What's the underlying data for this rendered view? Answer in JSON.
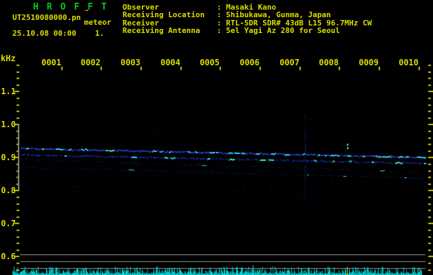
{
  "header": {
    "title": "HROFFT",
    "filename": "UT2510080000.pn",
    "filename_mark": "¨",
    "filename_overlay": "meteor",
    "datetime": "25.10.08 00:00",
    "page": "1.",
    "separator": ": ",
    "fields": [
      {
        "label": "Observer",
        "value": "Masaki Kano"
      },
      {
        "label": "Receiving Location",
        "value": "Shibukawa, Gunma, Japan"
      },
      {
        "label": "Receiver",
        "value": "RTL-SDR SDR# 43dB L15 96.7MHz CW"
      },
      {
        "label": "Receiving Antenna",
        "value": "5el Yagi Az 280 for Seoul"
      }
    ]
  },
  "axes": {
    "freq_unit": "kHz",
    "freq_ticks": [
      "1.1",
      "1.0",
      "0.9",
      "0.8",
      "0.7",
      "0.6"
    ],
    "time_ticks": [
      "0001'",
      "0002'",
      "0003'",
      "0004'",
      "0005'",
      "0006'",
      "0007'",
      "0008'",
      "0009'",
      "0010'"
    ]
  },
  "colors": {
    "title_green": "#00cc22",
    "text_yellow": "#dcdc00",
    "tick_yellow": "#c8c800",
    "gray_line": "#9a9a9a",
    "trace_blue": "#2850ff",
    "trace_bright_cyan": "#38d8ff",
    "trace_green_fleck": "#40ffa0",
    "echo_dot_green": "#3cf08c",
    "noise_cyan": "#00e4e4",
    "marker_yellow": "#dcdc00"
  },
  "chart_data": {
    "type": "heatmap",
    "title": "HROFFT 10-minute meteor radio spectrogram, 25.10.08 00:00 UT",
    "x_axis": {
      "tick_labels": [
        "0001'",
        "0002'",
        "0003'",
        "0004'",
        "0005'",
        "0006'",
        "0007'",
        "0008'",
        "0009'",
        "0010'"
      ],
      "range_minutes": [
        0,
        10
      ]
    },
    "y_axis": {
      "unit": "kHz",
      "tick_values": [
        1.1,
        1.0,
        0.9,
        0.8,
        0.7,
        0.6
      ],
      "range_khz": [
        1.18,
        0.56
      ],
      "minor_step_khz": 0.02
    },
    "marked_band_khz": [
      1.0,
      0.8
    ],
    "traces": [
      {
        "f_start_khz": 0.988,
        "f_end_khz": 0.951,
        "density": 0.3,
        "level": "faint"
      },
      {
        "f_start_khz": 0.929,
        "f_end_khz": 0.902,
        "density": 0.97,
        "level": "bright"
      },
      {
        "f_start_khz": 0.91,
        "f_end_khz": 0.884,
        "density": 0.8,
        "level": "medium"
      },
      {
        "f_start_khz": 0.896,
        "f_end_khz": 0.856,
        "density": 0.45,
        "level": "dim"
      },
      {
        "f_start_khz": 0.871,
        "f_end_khz": 0.838,
        "density": 0.55,
        "level": "dim"
      },
      {
        "f_start_khz": 0.814,
        "f_end_khz": 0.786,
        "density": 0.38,
        "level": "faint"
      },
      {
        "f_start_khz": 0.799,
        "f_end_khz": 0.767,
        "density": 0.18,
        "level": "faint"
      }
    ],
    "events": [
      {
        "kind": "meteor-echo-streak",
        "minute": 7.16,
        "f_top_khz": 1.03,
        "f_bottom_khz": 0.77
      },
      {
        "kind": "echo-dot",
        "minute": 8.22,
        "f_khz": 0.933
      }
    ],
    "noise_floor_graph": {
      "present": true,
      "ref_lines": 3,
      "marker_minute": 8.22
    }
  }
}
